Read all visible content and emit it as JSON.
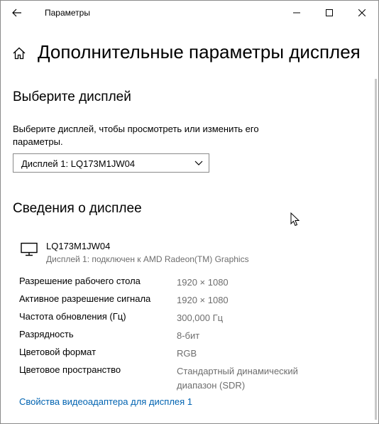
{
  "titlebar": {
    "app_title": "Параметры",
    "back_icon": "back-arrow-icon",
    "minimize_icon": "minimize-icon",
    "maximize_icon": "maximize-icon",
    "close_icon": "close-icon"
  },
  "page": {
    "title": "Дополнительные параметры дисплея",
    "home_icon": "home-icon"
  },
  "select_section": {
    "heading": "Выберите дисплей",
    "prompt": "Выберите дисплей, чтобы просмотреть или изменить его параметры.",
    "dropdown_value": "Дисплей 1: LQ173M1JW04"
  },
  "info_section": {
    "heading": "Сведения о дисплее",
    "display_name": "LQ173M1JW04",
    "display_subtitle": "Дисплей 1: подключен к AMD Radeon(TM) Graphics",
    "rows": [
      {
        "label": "Разрешение рабочего стола",
        "value": "1920 × 1080"
      },
      {
        "label": "Активное разрешение сигнала",
        "value": "1920 × 1080"
      },
      {
        "label": "Частота обновления (Гц)",
        "value": "300,000 Гц"
      },
      {
        "label": "Разрядность",
        "value": "8-бит"
      },
      {
        "label": "Цветовой формат",
        "value": "RGB"
      },
      {
        "label": "Цветовое пространство",
        "value": "Стандартный динамический диапазон (SDR)"
      }
    ],
    "adapter_link": "Свойства видеоадаптера для дисплея 1"
  },
  "colors": {
    "link": "#0063b1",
    "secondary_text": "#6e6e6e"
  }
}
